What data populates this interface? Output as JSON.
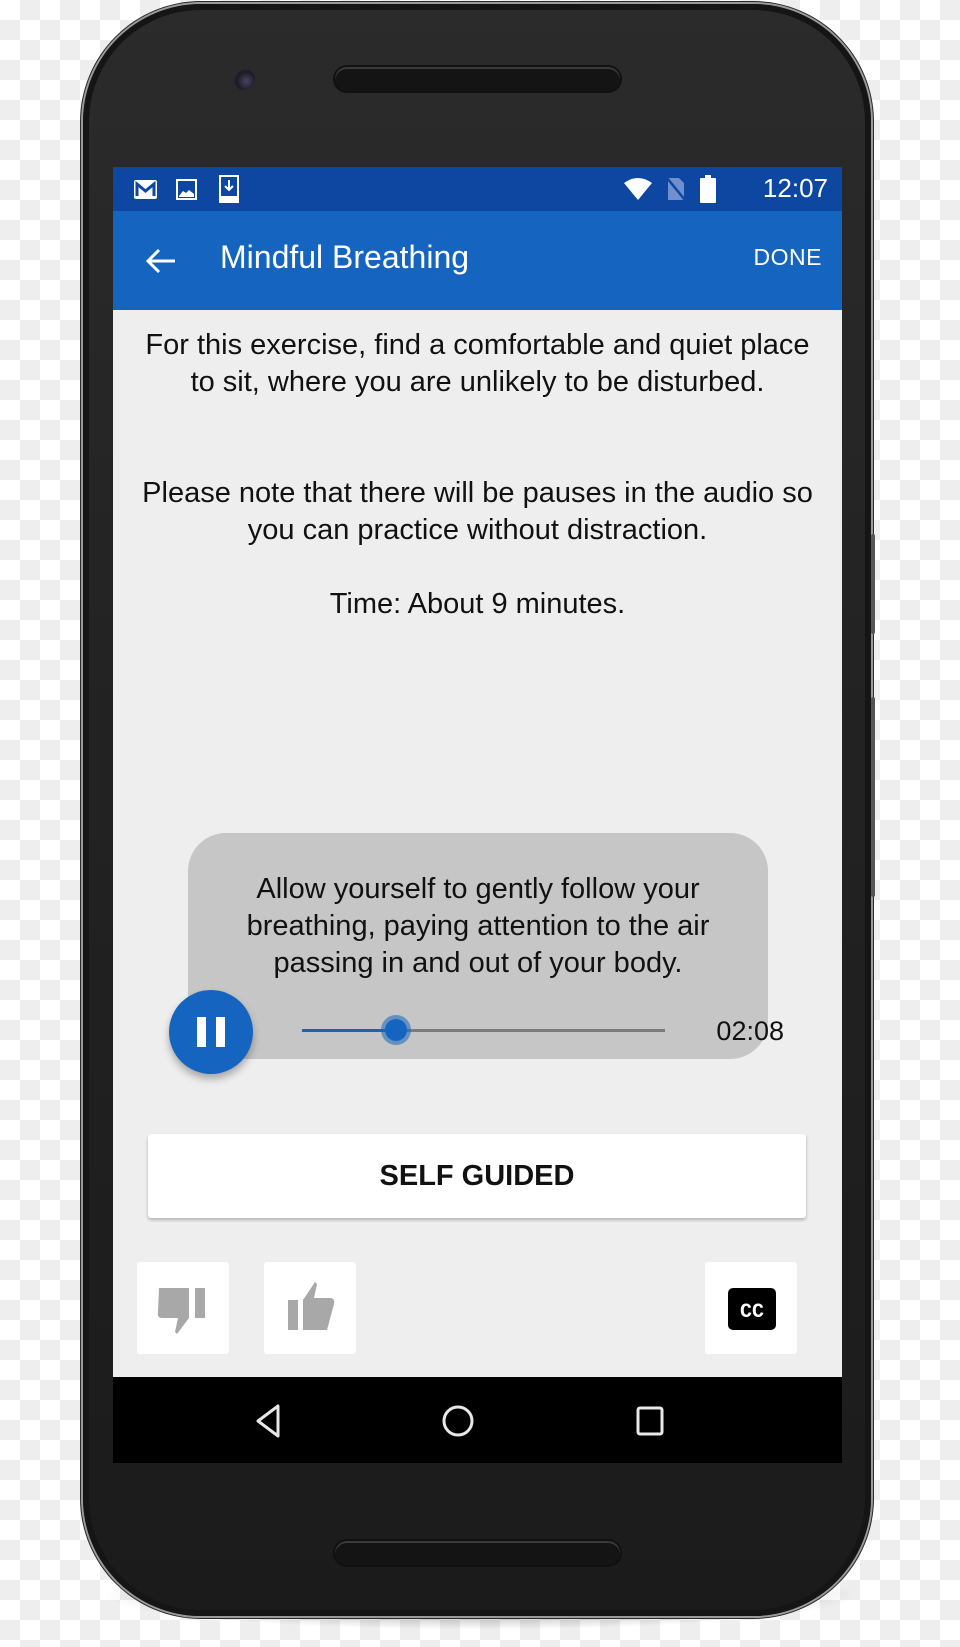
{
  "status_bar": {
    "time": "12:07",
    "left_icons": [
      "gmail-icon",
      "image-icon",
      "download-icon"
    ],
    "right_icons": [
      "wifi-icon",
      "no-sim-icon",
      "battery-icon"
    ]
  },
  "app_bar": {
    "title": "Mindful Breathing",
    "back_icon": "arrow-back-icon",
    "done_label": "DONE"
  },
  "content": {
    "intro_paragraphs": [
      "For this exercise, find a comfortable and quiet place to sit, where you are unlikely to be disturbed.",
      "Please note that there will be pauses in the audio so you can practice without distraction.",
      "Time: About 9 minutes."
    ],
    "caption": "Allow yourself to gently follow your breathing, paying attention to the air passing in and out of your body."
  },
  "player": {
    "state": "playing",
    "button_icon": "pause-icon",
    "elapsed": "02:08",
    "progress": 0.26
  },
  "self_guided_label": "SELF GUIDED",
  "feedback": {
    "thumbs_down_icon": "thumbs-down-icon",
    "thumbs_up_icon": "thumbs-up-icon",
    "captions_icon": "closed-captions-icon",
    "captions_text": "CC"
  },
  "nav_bar": {
    "buttons": [
      "back-triangle-icon",
      "home-circle-icon",
      "recents-square-icon"
    ]
  },
  "colors": {
    "status_bar": "#0d47a1",
    "app_bar": "#1565c0",
    "accent": "#1565c0",
    "background": "#eeeeee",
    "caption_box": "#c6c6c6",
    "icon_gray": "#a8a8a8"
  }
}
